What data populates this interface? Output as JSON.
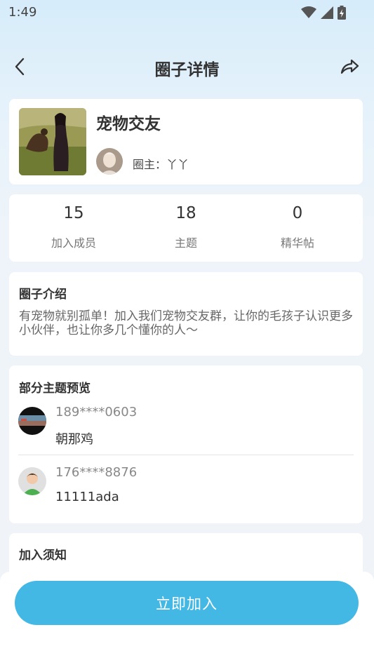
{
  "status_bar": {
    "time": "1:49"
  },
  "nav": {
    "title": "圈子详情"
  },
  "circle": {
    "name": "宠物交友",
    "owner_label": "圈主：丫丫"
  },
  "stats": [
    {
      "value": "15",
      "label": "加入成员"
    },
    {
      "value": "18",
      "label": "主题"
    },
    {
      "value": "0",
      "label": "精华帖"
    }
  ],
  "intro": {
    "title": "圈子介绍",
    "text": "有宠物就别孤单！加入我们宠物交友群，让你的毛孩子认识更多小伙伴，也让你多几个懂你的人～"
  },
  "preview": {
    "title": "部分主题预览",
    "topics": [
      {
        "user": "189****0603",
        "title": "朝那鸡"
      },
      {
        "user": "176****8876",
        "title": "11111ada"
      }
    ]
  },
  "notice": {
    "title": "加入须知"
  },
  "actions": {
    "join_label": "立即加入"
  },
  "colors": {
    "accent": "#44b8e4",
    "background": "#eef4f9"
  }
}
